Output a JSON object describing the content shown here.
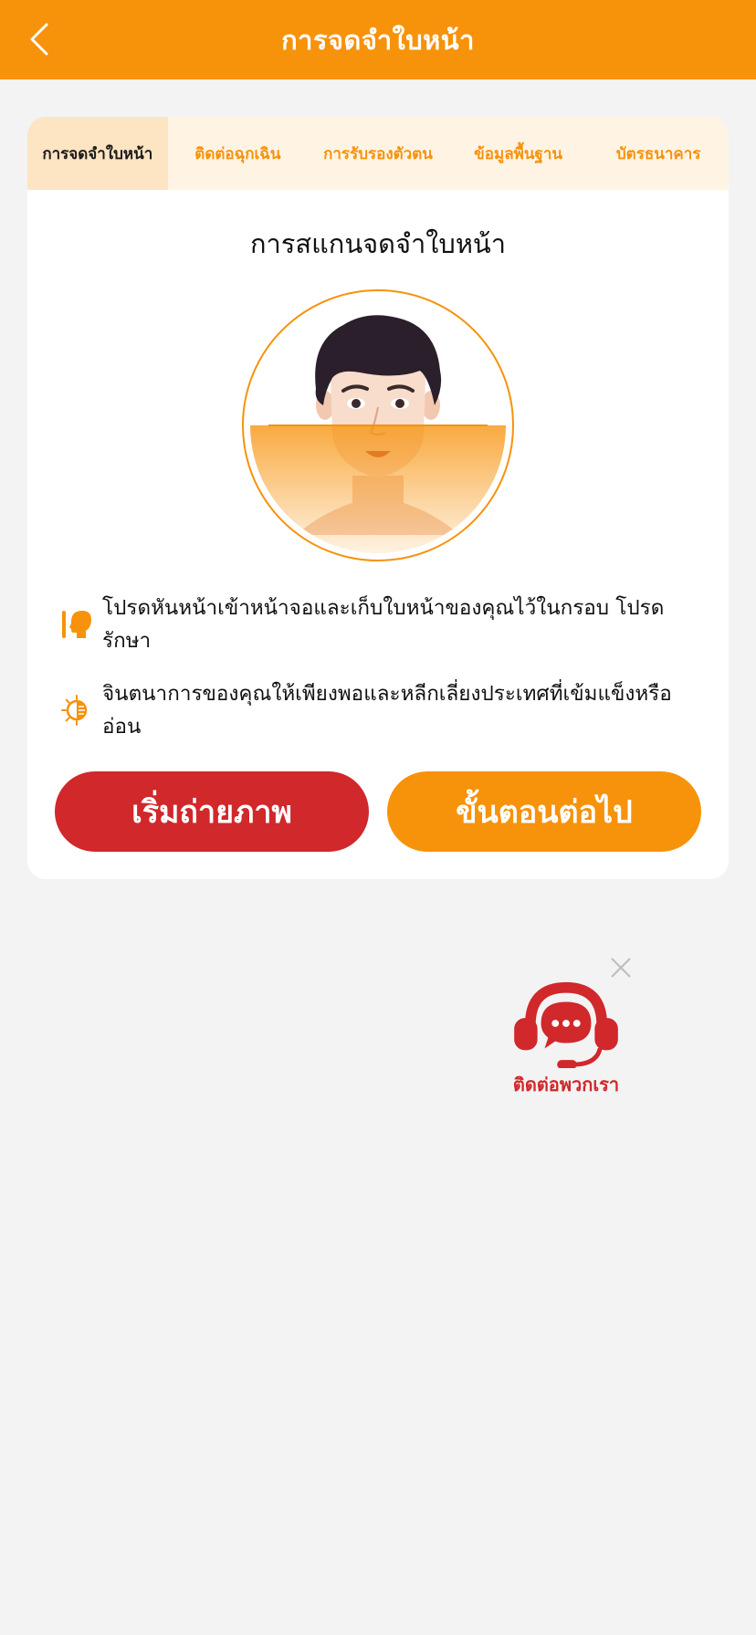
{
  "header": {
    "title": "การจดจำใบหน้า"
  },
  "tabs": [
    {
      "label": "การจดจำใบหน้า",
      "active": true
    },
    {
      "label": "ติดต่อฉุกเฉิน",
      "active": false
    },
    {
      "label": "การรับรองตัวตน",
      "active": false
    },
    {
      "label": "ข้อมูลพื้นฐาน",
      "active": false
    },
    {
      "label": "บัตรธนาคาร",
      "active": false
    }
  ],
  "scan": {
    "title": "การสแกนจดจำใบหน้า",
    "tips": [
      {
        "icon": "face-profile-icon",
        "text": "โปรดหันหน้าเข้าหน้าจอและเก็บใบหน้าของคุณไว้ในกรอบ โปรดรักษา"
      },
      {
        "icon": "brightness-icon",
        "text": "จินตนาการของคุณให้เพียงพอและหลีกเลี่ยงประเทศที่เข้มแข็งหรืออ่อน"
      }
    ]
  },
  "buttons": {
    "start": "เริ่มถ่ายภาพ",
    "next": "ขั้นตอนต่อไป"
  },
  "contact": {
    "label": "ติดต่อพวกเรา"
  },
  "colors": {
    "primary": "#f7920b",
    "danger": "#d0282b",
    "tab_bg": "#fff4e4",
    "tab_active_bg": "#fde4c2"
  }
}
